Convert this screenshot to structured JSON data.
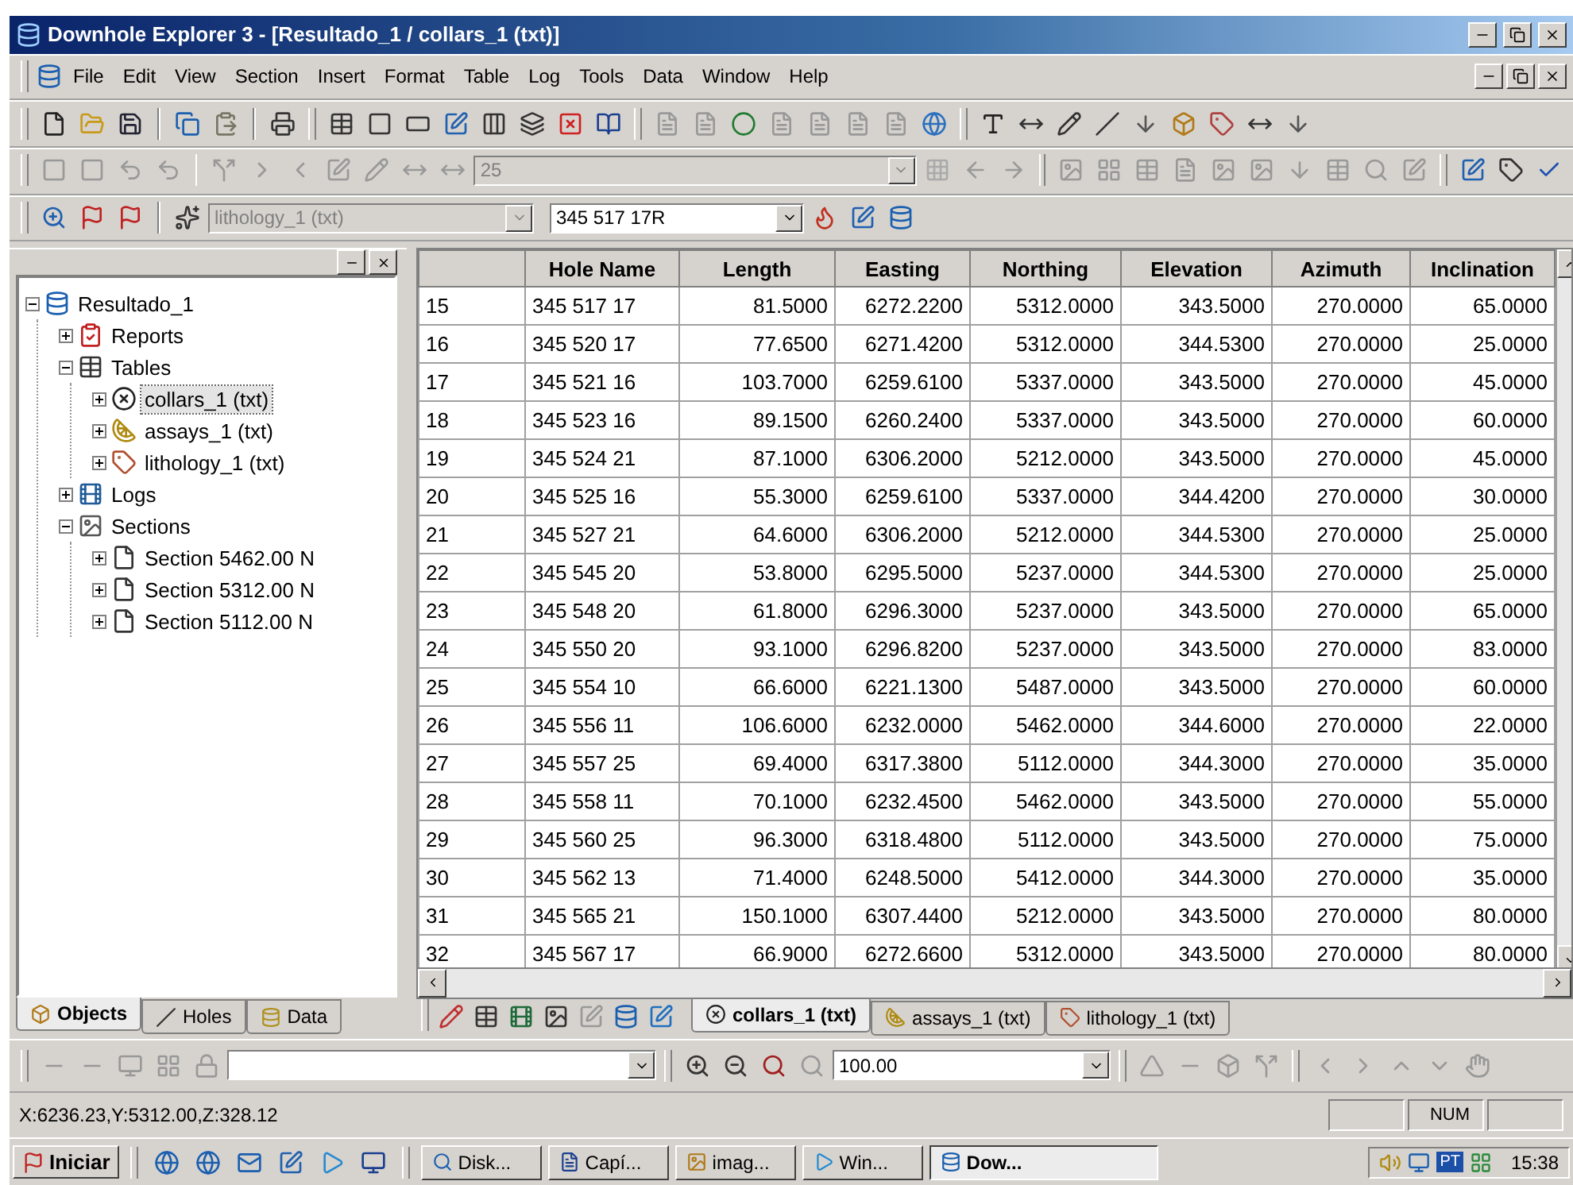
{
  "window": {
    "title": "Downhole Explorer 3 - [Resultado_1 / collars_1 (txt)]"
  },
  "menu": [
    "File",
    "Edit",
    "View",
    "Section",
    "Insert",
    "Format",
    "Table",
    "Log",
    "Tools",
    "Data",
    "Window",
    "Help"
  ],
  "toolbar_2": {
    "depth_field": {
      "value": "25",
      "disabled": true
    }
  },
  "toolbar_3": {
    "layer_select": {
      "value": "lithology_1 (txt)",
      "disabled": true
    },
    "hole_select": {
      "value": "345 517 17R",
      "disabled": false
    }
  },
  "tree": [
    {
      "label": "Resultado_1",
      "expanded": true,
      "selected": false,
      "children": [
        {
          "label": "Reports",
          "expanded": false,
          "selected": false
        },
        {
          "label": "Tables",
          "expanded": true,
          "selected": false,
          "children": [
            {
              "label": "collars_1 (txt)",
              "expanded": false,
              "selected": true
            },
            {
              "label": "assays_1 (txt)",
              "expanded": false,
              "selected": false
            },
            {
              "label": "lithology_1 (txt)",
              "expanded": false,
              "selected": false
            }
          ]
        },
        {
          "label": "Logs",
          "expanded": false,
          "selected": false
        },
        {
          "label": "Sections",
          "expanded": true,
          "selected": false,
          "children": [
            {
              "label": "Section 5462.00 N",
              "expanded": false,
              "selected": false
            },
            {
              "label": "Section 5312.00 N",
              "expanded": false,
              "selected": false
            },
            {
              "label": "Section 5112.00 N",
              "expanded": false,
              "selected": false
            }
          ]
        }
      ]
    }
  ],
  "panel_tabs": [
    {
      "label": "Objects",
      "selected": true
    },
    {
      "label": "Holes",
      "selected": false
    },
    {
      "label": "Data",
      "selected": false
    }
  ],
  "table": {
    "columns": [
      "Hole Name",
      "Length",
      "Easting",
      "Northing",
      "Elevation",
      "Azimuth",
      "Inclination"
    ],
    "rows": [
      {
        "index": "15",
        "cells": [
          "345 517 17",
          "81.5000",
          "6272.2200",
          "5312.0000",
          "343.5000",
          "270.0000",
          "65.0000"
        ]
      },
      {
        "index": "16",
        "cells": [
          "345 520 17",
          "77.6500",
          "6271.4200",
          "5312.0000",
          "344.5300",
          "270.0000",
          "25.0000"
        ]
      },
      {
        "index": "17",
        "cells": [
          "345 521 16",
          "103.7000",
          "6259.6100",
          "5337.0000",
          "343.5000",
          "270.0000",
          "45.0000"
        ]
      },
      {
        "index": "18",
        "cells": [
          "345 523 16",
          "89.1500",
          "6260.2400",
          "5337.0000",
          "343.5000",
          "270.0000",
          "60.0000"
        ]
      },
      {
        "index": "19",
        "cells": [
          "345 524 21",
          "87.1000",
          "6306.2000",
          "5212.0000",
          "343.5000",
          "270.0000",
          "45.0000"
        ]
      },
      {
        "index": "20",
        "cells": [
          "345 525 16",
          "55.3000",
          "6259.6100",
          "5337.0000",
          "344.4200",
          "270.0000",
          "30.0000"
        ]
      },
      {
        "index": "21",
        "cells": [
          "345 527 21",
          "64.6000",
          "6306.2000",
          "5212.0000",
          "344.5300",
          "270.0000",
          "25.0000"
        ]
      },
      {
        "index": "22",
        "cells": [
          "345 545 20",
          "53.8000",
          "6295.5000",
          "5237.0000",
          "344.5300",
          "270.0000",
          "25.0000"
        ]
      },
      {
        "index": "23",
        "cells": [
          "345 548 20",
          "61.8000",
          "6296.3000",
          "5237.0000",
          "343.5000",
          "270.0000",
          "65.0000"
        ]
      },
      {
        "index": "24",
        "cells": [
          "345 550 20",
          "93.1000",
          "6296.8200",
          "5237.0000",
          "343.5000",
          "270.0000",
          "83.0000"
        ]
      },
      {
        "index": "25",
        "cells": [
          "345 554 10",
          "66.6000",
          "6221.1300",
          "5487.0000",
          "343.5000",
          "270.0000",
          "60.0000"
        ]
      },
      {
        "index": "26",
        "cells": [
          "345 556 11",
          "106.6000",
          "6232.0000",
          "5462.0000",
          "344.6000",
          "270.0000",
          "22.0000"
        ]
      },
      {
        "index": "27",
        "cells": [
          "345 557 25",
          "69.4000",
          "6317.3800",
          "5112.0000",
          "344.3000",
          "270.0000",
          "35.0000"
        ]
      },
      {
        "index": "28",
        "cells": [
          "345 558 11",
          "70.1000",
          "6232.4500",
          "5462.0000",
          "343.5000",
          "270.0000",
          "55.0000"
        ]
      },
      {
        "index": "29",
        "cells": [
          "345 560 25",
          "96.3000",
          "6318.4800",
          "5112.0000",
          "343.5000",
          "270.0000",
          "75.0000"
        ]
      },
      {
        "index": "30",
        "cells": [
          "345 562 13",
          "71.4000",
          "6248.5000",
          "5412.0000",
          "344.3000",
          "270.0000",
          "35.0000"
        ]
      },
      {
        "index": "31",
        "cells": [
          "345 565 21",
          "150.1000",
          "6307.4400",
          "5212.0000",
          "343.5000",
          "270.0000",
          "80.0000"
        ]
      },
      {
        "index": "32",
        "cells": [
          "345 567 17",
          "66.9000",
          "6272.6600",
          "5312.0000",
          "343.5000",
          "270.0000",
          "80.0000"
        ]
      }
    ]
  },
  "table_tabs": [
    {
      "label": "collars_1 (txt)",
      "selected": true
    },
    {
      "label": "assays_1 (txt)",
      "selected": false
    },
    {
      "label": "lithology_1 (txt)",
      "selected": false
    }
  ],
  "bottom_toolbar": {
    "zoom_select": {
      "value": "100.00"
    }
  },
  "status_bar": {
    "coordinates": "X:6236.23,Y:5312.00,Z:328.12",
    "indicators": [
      "NUM"
    ]
  },
  "taskbar": {
    "start": "Iniciar",
    "tasks": [
      {
        "label": "Disk...",
        "selected": false
      },
      {
        "label": "Capí...",
        "selected": false
      },
      {
        "label": "imag...",
        "selected": false
      },
      {
        "label": "Win...",
        "selected": false
      },
      {
        "label": "Dow...",
        "selected": true
      }
    ],
    "language": "PT",
    "clock": "15:38"
  }
}
